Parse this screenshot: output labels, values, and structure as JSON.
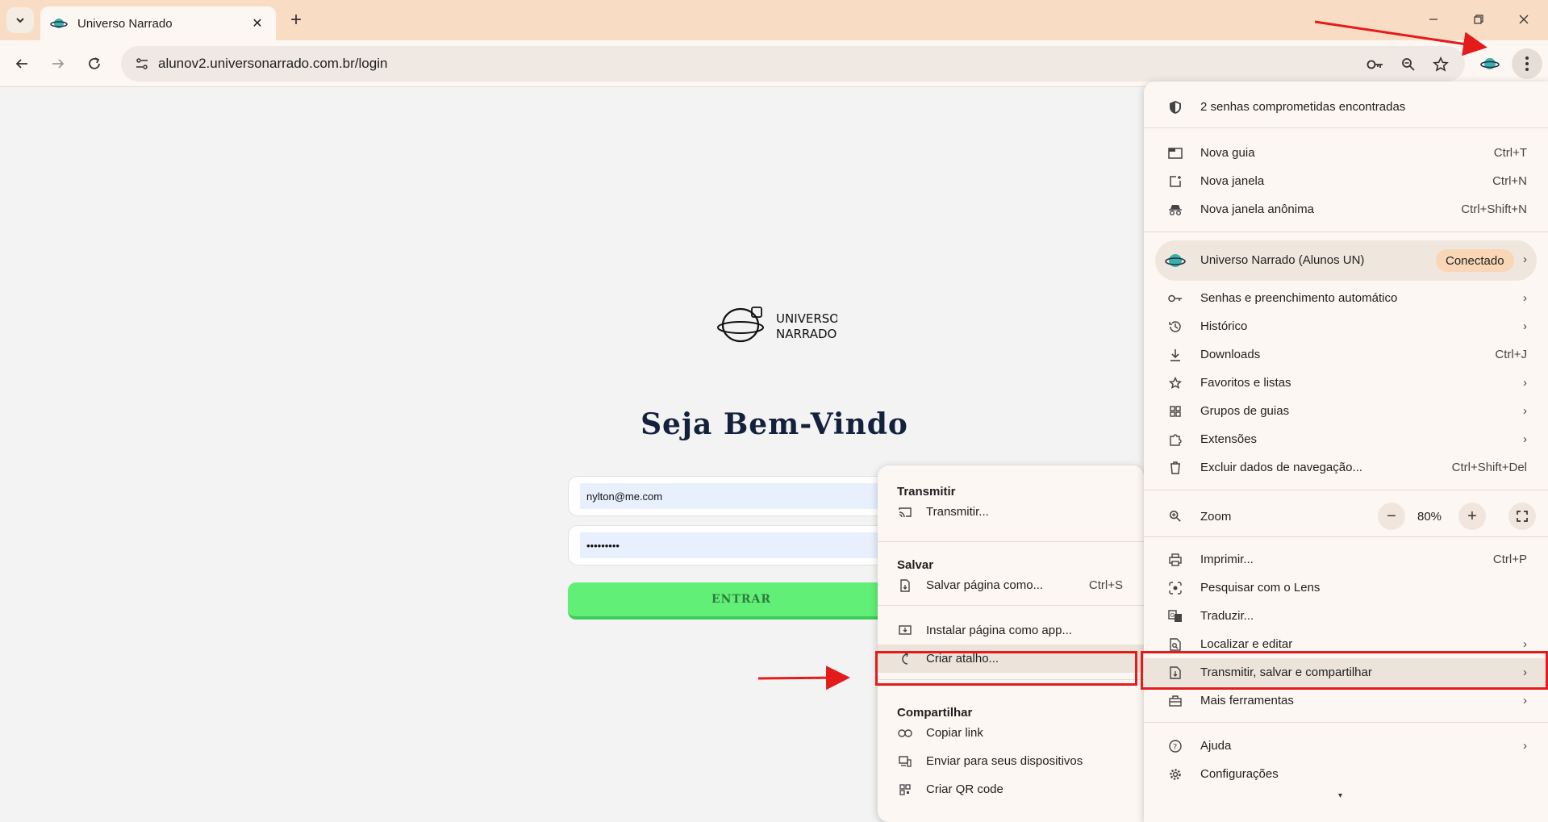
{
  "tab": {
    "title": "Universo Narrado"
  },
  "toolbar": {
    "url": "alunov2.universonarrado.com.br/login"
  },
  "page": {
    "logo_line1": "UNIVERSO",
    "logo_line2": "NARRADO",
    "heading": "Seja Bem-Vindo",
    "email_value": "nylton@me.com",
    "password_value": "•••••••••",
    "enter_label": "ENTRAR"
  },
  "menu": {
    "alert": "2 senhas comprometidas encontradas",
    "new_tab": "Nova guia",
    "new_tab_sc": "Ctrl+T",
    "new_window": "Nova janela",
    "new_window_sc": "Ctrl+N",
    "incognito": "Nova janela anônima",
    "incognito_sc": "Ctrl+Shift+N",
    "profile_name": "Universo Narrado (Alunos UN)",
    "profile_status": "Conectado",
    "passwords": "Senhas e preenchimento automático",
    "history": "Histórico",
    "downloads": "Downloads",
    "downloads_sc": "Ctrl+J",
    "bookmarks": "Favoritos e listas",
    "tab_groups": "Grupos de guias",
    "extensions": "Extensões",
    "clear_data": "Excluir dados de navegação...",
    "clear_data_sc": "Ctrl+Shift+Del",
    "zoom": "Zoom",
    "zoom_value": "80%",
    "print": "Imprimir...",
    "print_sc": "Ctrl+P",
    "lens": "Pesquisar com o Lens",
    "translate": "Traduzir...",
    "find": "Localizar e editar",
    "cast_save_share": "Transmitir, salvar e compartilhar",
    "more_tools": "Mais ferramentas",
    "help": "Ajuda",
    "settings": "Configurações"
  },
  "submenu": {
    "cast_header": "Transmitir",
    "cast": "Transmitir...",
    "save_header": "Salvar",
    "save_page": "Salvar página como...",
    "save_page_sc": "Ctrl+S",
    "install_app": "Instalar página como app...",
    "create_shortcut": "Criar atalho...",
    "share_header": "Compartilhar",
    "copy_link": "Copiar link",
    "send_devices": "Enviar para seus dispositivos",
    "qr_code": "Criar QR code"
  },
  "colors": {
    "accent_red": "#e41b1b",
    "enter_green": "#62ef78",
    "tabstrip": "#f9dcc4"
  }
}
